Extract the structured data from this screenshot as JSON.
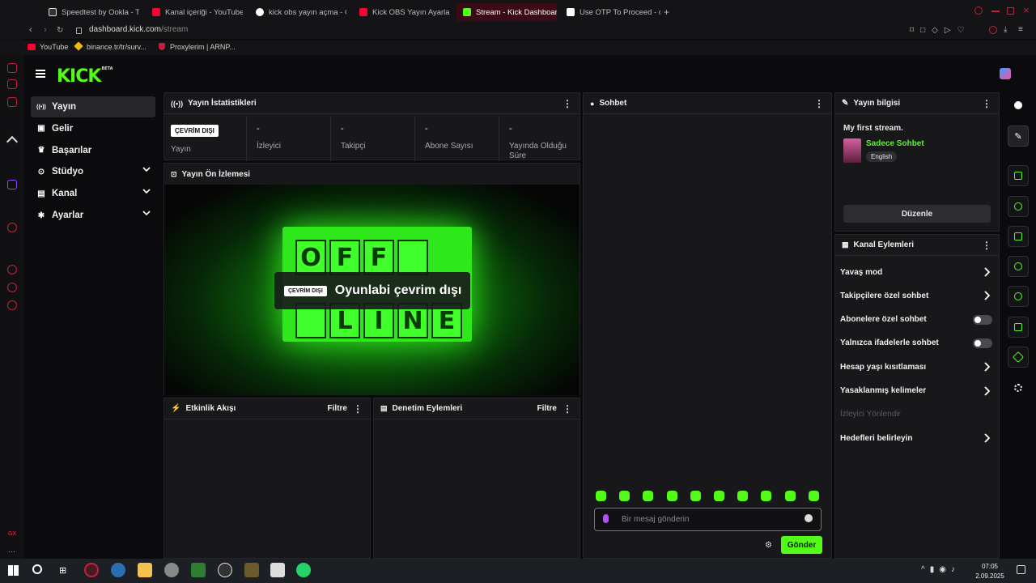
{
  "browser": {
    "tabs": [
      {
        "title": "Speedtest by Ookla - The",
        "active": false
      },
      {
        "title": "Kanal içeriği - YouTube St",
        "active": false
      },
      {
        "title": "kick obs yayın açma - Go",
        "active": false
      },
      {
        "title": "Kick OBS Yayın Ayarları N",
        "active": false
      },
      {
        "title": "Stream - Kick Dashboard",
        "active": true
      },
      {
        "title": "Use OTP To Proceed - ori",
        "active": false
      }
    ],
    "url_host": "dashboard.kick.com",
    "url_path": "/stream",
    "bookmarks": [
      "YouTube",
      "binance.tr/tr/surv...",
      "Proxylerim | ARNP..."
    ]
  },
  "app": {
    "logo": "KICK",
    "logo_tag": "BETA",
    "accent": "#53fc18"
  },
  "nav": [
    {
      "label": "Yayın",
      "icon": "broadcast-icon",
      "active": true,
      "chevron": false
    },
    {
      "label": "Gelir",
      "icon": "revenue-icon",
      "active": false,
      "chevron": false
    },
    {
      "label": "Başarılar",
      "icon": "trophy-icon",
      "active": false,
      "chevron": false
    },
    {
      "label": "Stüdyo",
      "icon": "studio-icon",
      "active": false,
      "chevron": true
    },
    {
      "label": "Kanal",
      "icon": "channel-icon",
      "active": false,
      "chevron": true
    },
    {
      "label": "Ayarlar",
      "icon": "gear-icon",
      "active": false,
      "chevron": true
    }
  ],
  "stats": {
    "title": "Yayın İstatistikleri",
    "status_badge": "ÇEVRİM DIŞI",
    "items": [
      {
        "value": "",
        "label": "Yayın"
      },
      {
        "value": "-",
        "label": "İzleyici"
      },
      {
        "value": "-",
        "label": "Takipçi"
      },
      {
        "value": "-",
        "label": "Abone Sayısı"
      },
      {
        "value": "-",
        "label": "Yayında Olduğu Süre"
      }
    ]
  },
  "preview": {
    "title": "Yayın Ön İzlemesi",
    "badge": "ÇEVRİM DIŞI",
    "message": "Oyunlabi çevrim dışı",
    "offline_top": [
      "O",
      "F",
      "F",
      ""
    ],
    "offline_bottom": [
      "",
      "L",
      "I",
      "N",
      "E"
    ]
  },
  "events": {
    "title": "Etkinlik Akışı",
    "filter": "Filtre"
  },
  "moderation": {
    "title": "Denetim Eylemleri",
    "filter": "Filtre"
  },
  "chat": {
    "title": "Sohbet",
    "placeholder": "Bir mesaj gönderin",
    "send": "Gönder"
  },
  "streaminfo": {
    "title": "Yayın bilgisi",
    "stream_title": "My first stream.",
    "category": "Sadece Sohbet",
    "language": "English",
    "edit": "Düzenle"
  },
  "channel_actions": {
    "title": "Kanal Eylemleri",
    "items": [
      {
        "label": "Yavaş mod",
        "type": "arrow"
      },
      {
        "label": "Takipçilere özel sohbet",
        "type": "arrow"
      },
      {
        "label": "Abonelere özel sohbet",
        "type": "toggle"
      },
      {
        "label": "Yalnızca ifadelerle sohbet",
        "type": "toggle"
      },
      {
        "label": "Hesap yaşı kısıtlaması",
        "type": "arrow"
      },
      {
        "label": "Yasaklanmış kelimeler",
        "type": "arrow"
      },
      {
        "label": "İzleyici Yönlendir",
        "type": "disabled"
      },
      {
        "label": "Hedefleri belirleyin",
        "type": "arrow"
      }
    ]
  },
  "taskbar": {
    "time": "07:05",
    "date": "2.09.2025"
  }
}
